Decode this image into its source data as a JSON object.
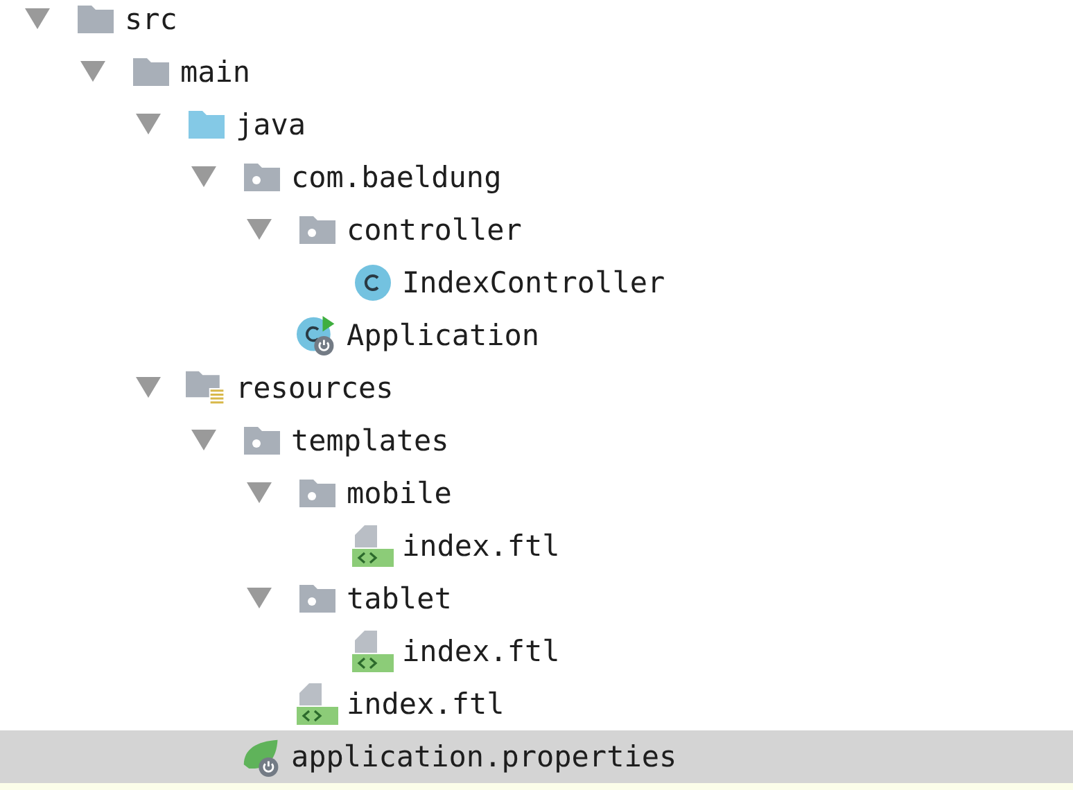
{
  "tree": [
    {
      "label": "src",
      "kind": "folder",
      "expanded": true,
      "selected": false,
      "children": [
        {
          "label": "main",
          "kind": "folder",
          "expanded": true,
          "selected": false,
          "children": [
            {
              "label": "java",
              "kind": "source-folder",
              "expanded": true,
              "selected": false,
              "children": [
                {
                  "label": "com.baeldung",
                  "kind": "package",
                  "expanded": true,
                  "selected": false,
                  "children": [
                    {
                      "label": "controller",
                      "kind": "package",
                      "expanded": true,
                      "selected": false,
                      "children": [
                        {
                          "label": "IndexController",
                          "kind": "class",
                          "selected": false
                        }
                      ]
                    },
                    {
                      "label": "Application",
                      "kind": "spring-class",
                      "selected": false
                    }
                  ]
                }
              ]
            },
            {
              "label": "resources",
              "kind": "resource-folder",
              "expanded": true,
              "selected": false,
              "children": [
                {
                  "label": "templates",
                  "kind": "package",
                  "expanded": true,
                  "selected": false,
                  "children": [
                    {
                      "label": "mobile",
                      "kind": "package",
                      "expanded": true,
                      "selected": false,
                      "children": [
                        {
                          "label": "index.ftl",
                          "kind": "template",
                          "selected": false
                        }
                      ]
                    },
                    {
                      "label": "tablet",
                      "kind": "package",
                      "expanded": true,
                      "selected": false,
                      "children": [
                        {
                          "label": "index.ftl",
                          "kind": "template",
                          "selected": false
                        }
                      ]
                    },
                    {
                      "label": "index.ftl",
                      "kind": "template",
                      "selected": false
                    }
                  ]
                },
                {
                  "label": "application.properties",
                  "kind": "properties",
                  "selected": true
                }
              ]
            }
          ]
        }
      ]
    }
  ]
}
